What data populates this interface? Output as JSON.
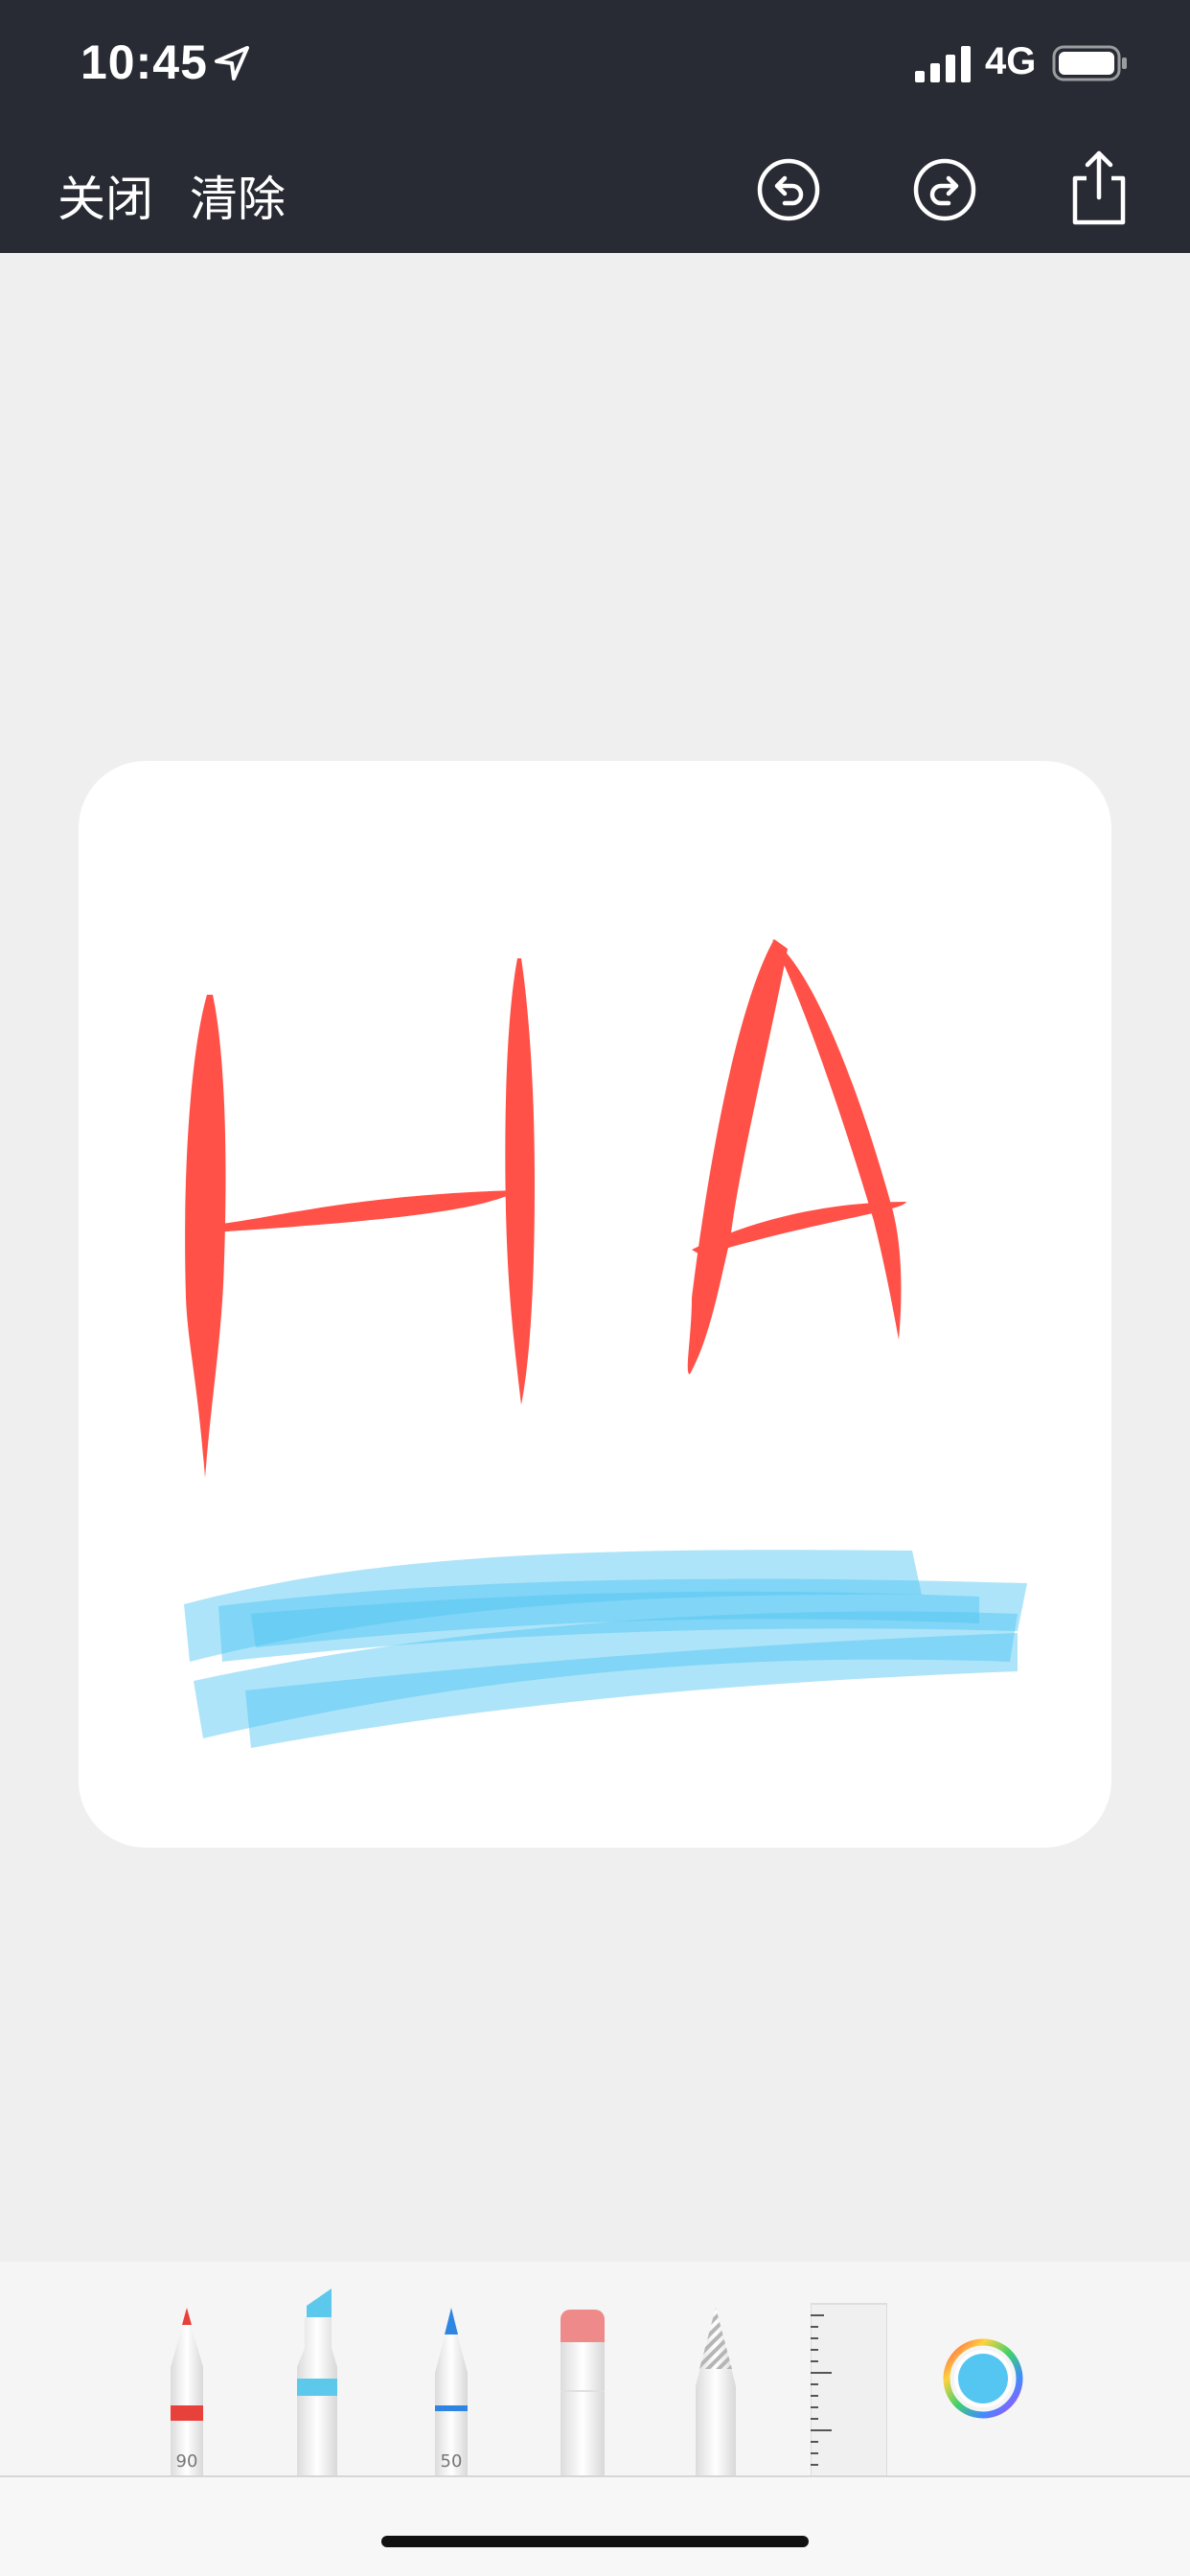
{
  "status_bar": {
    "time": "10:45",
    "network": "4G",
    "icons": [
      "location-arrow-icon",
      "signal-bars-icon",
      "battery-icon"
    ]
  },
  "toolbar": {
    "close_label": "关闭",
    "clear_label": "清除",
    "icons": [
      "undo-icon",
      "redo-icon",
      "share-icon"
    ]
  },
  "canvas": {
    "drawn_text": "HA",
    "stroke_colors": {
      "red": "#ff5147",
      "blue": "#4cc3f2"
    }
  },
  "tools": [
    {
      "name": "pen",
      "label": "90",
      "color": "#e8403a"
    },
    {
      "name": "marker",
      "label": "",
      "color": "#5cc8ec"
    },
    {
      "name": "pencil",
      "label": "50",
      "color": "#2f86e2"
    },
    {
      "name": "eraser",
      "label": "",
      "color": "#ee8a8a"
    },
    {
      "name": "lasso",
      "label": "",
      "color": "#bbbbbb"
    },
    {
      "name": "ruler",
      "label": "",
      "color": "#f0f0f0"
    }
  ],
  "color_picker": {
    "selected_color": "#55c6f2"
  }
}
